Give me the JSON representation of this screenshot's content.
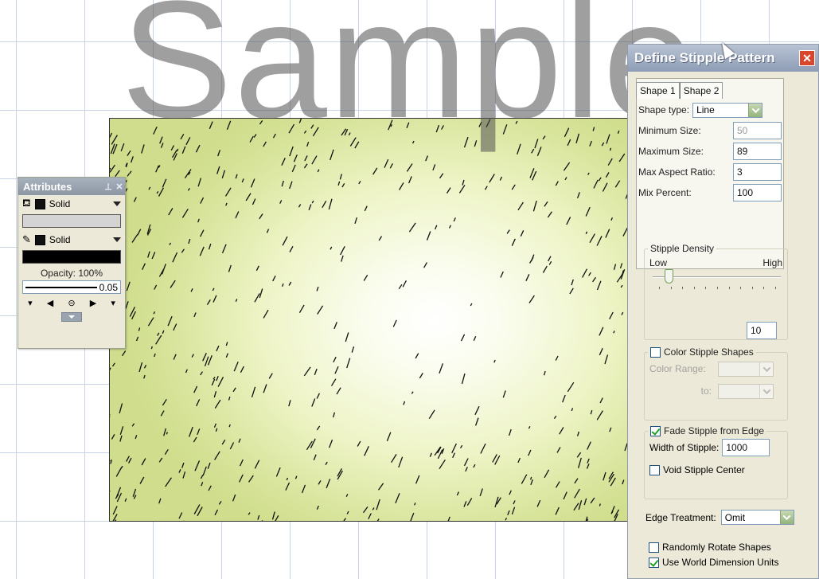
{
  "watermark": "Sample",
  "attributes_panel": {
    "title": "Attributes",
    "pin_icon": "pin-icon",
    "close_icon": "close-icon",
    "fill": {
      "icon": "paint-bucket-icon",
      "style": "Solid",
      "color": "#d4d4d4"
    },
    "stroke": {
      "icon": "pencil-icon",
      "style": "Solid",
      "color": "#000000"
    },
    "opacity_label": "Opacity: 100%",
    "stroke_width": "0.05"
  },
  "dialog": {
    "title": "Define Stipple Pattern",
    "tabs": [
      {
        "label": "Shape 1",
        "active": true
      },
      {
        "label": "Shape 2",
        "active": false
      }
    ],
    "shape_type": {
      "label": "Shape type:",
      "value": "Line"
    },
    "minimum_size": {
      "label": "Minimum Size:",
      "value": "50"
    },
    "maximum_size": {
      "label": "Maximum Size:",
      "value": "89"
    },
    "max_aspect_ratio": {
      "label": "Max Aspect Ratio:",
      "value": "3"
    },
    "mix_percent": {
      "label": "Mix Percent:",
      "value": "100"
    },
    "stipple_density": {
      "legend": "Stipple Density",
      "low_label": "Low",
      "high_label": "High",
      "value": "10",
      "level": 0.1
    },
    "color_stipple": {
      "legend": "Color Stipple Shapes",
      "checked": false,
      "color_range_label": "Color Range:",
      "to_label": "to:"
    },
    "fade": {
      "legend": "Fade Stipple from Edge",
      "checked": true,
      "width_label": "Width of Stipple:",
      "width_value": "1000",
      "void_label": "Void Stipple Center",
      "void_checked": false
    },
    "edge_treatment": {
      "label": "Edge Treatment:",
      "value": "Omit"
    },
    "randomly_rotate": {
      "label": "Randomly Rotate Shapes",
      "checked": false
    },
    "world_units": {
      "label": "Use World Dimension Units",
      "checked": true
    }
  },
  "colors": {
    "canvas_edge": "#cfdd8c",
    "canvas_center": "#ffffff",
    "titlebar": "#8e9db5",
    "close_button": "#d8462c",
    "check_green": "#21a121"
  }
}
